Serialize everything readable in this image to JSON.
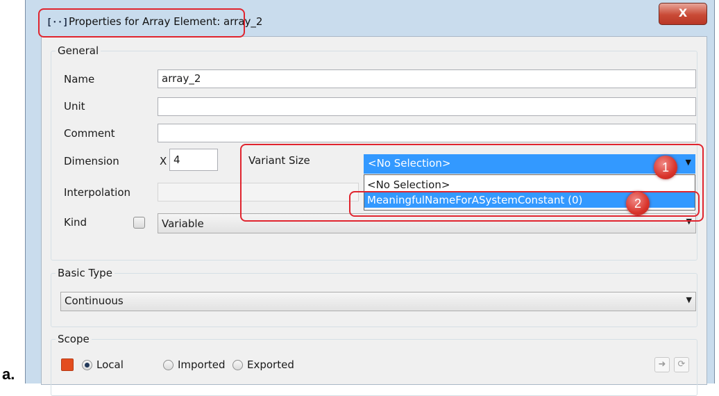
{
  "figure_label": "a.",
  "window": {
    "title_icon": "[··]",
    "title": "Properties for Array Element: array_2",
    "close_label": "X"
  },
  "general": {
    "group_title": "General",
    "name_label": "Name",
    "name_value": "array_2",
    "unit_label": "Unit",
    "unit_value": "",
    "comment_label": "Comment",
    "comment_value": "",
    "dimension_label": "Dimension",
    "dimension_x_label": "X",
    "dimension_x_value": "4",
    "variant_size_label": "Variant Size",
    "variant_size_selected": "<No Selection>",
    "variant_size_options": [
      "<No Selection>",
      "MeaningfulNameForASystemConstant (0)"
    ],
    "interpolation_label": "Interpolation",
    "kind_label": "Kind",
    "kind_value": "Variable"
  },
  "basic_type": {
    "group_title": "Basic Type",
    "value": "Continuous"
  },
  "scope": {
    "group_title": "Scope",
    "options": [
      "Local",
      "Imported",
      "Exported"
    ],
    "selected": "Local",
    "color": "#e34d1f"
  },
  "annotations": {
    "badge_1": "1",
    "badge_2": "2",
    "highlight_color": "#e0242e"
  }
}
